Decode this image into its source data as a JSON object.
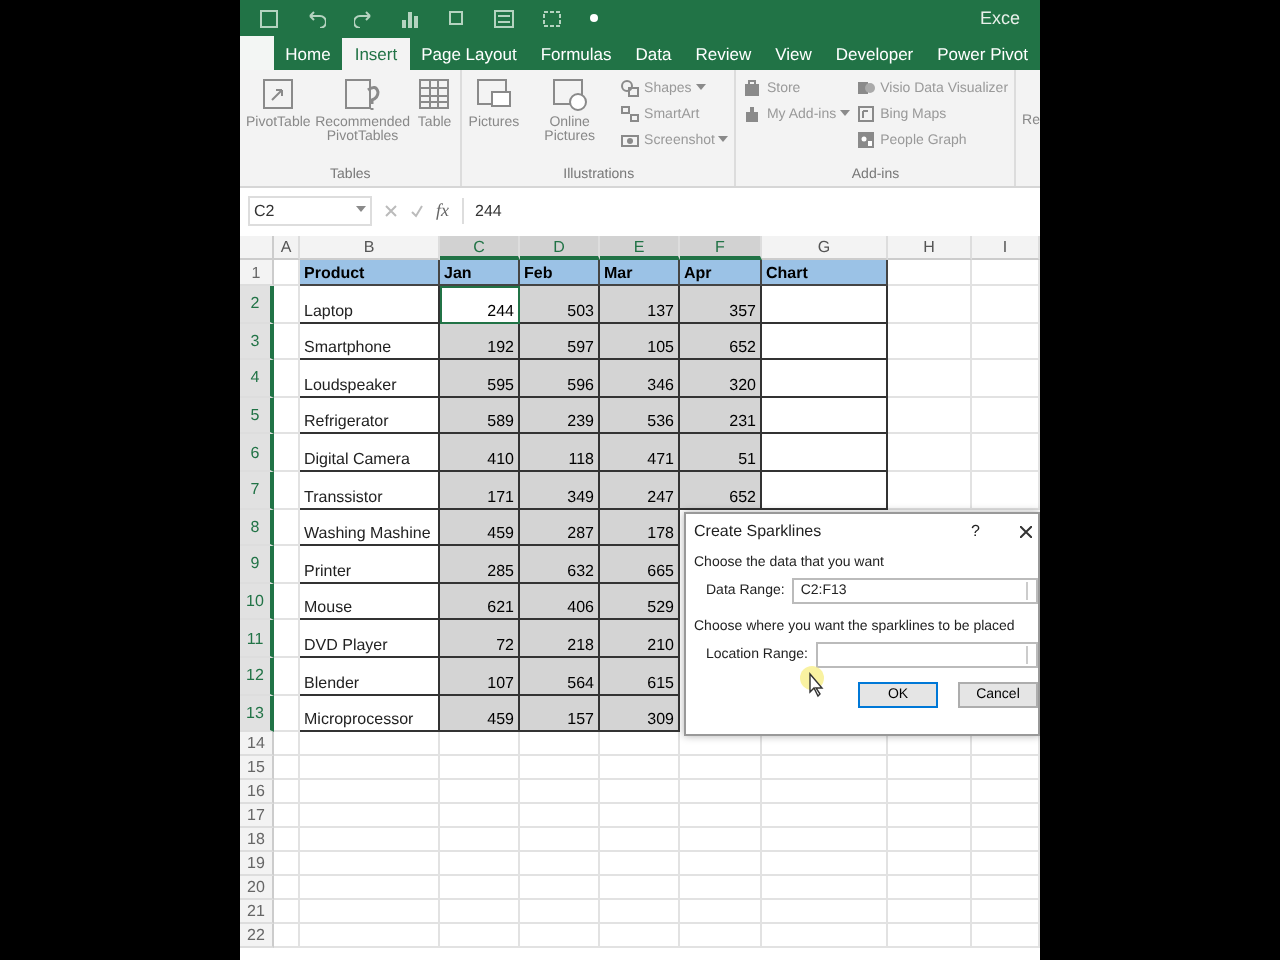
{
  "title_bar": {
    "app_title": "Exce"
  },
  "tabs": [
    {
      "label": "Home",
      "selected": false
    },
    {
      "label": "Insert",
      "selected": true
    },
    {
      "label": "Page Layout",
      "selected": false
    },
    {
      "label": "Formulas",
      "selected": false
    },
    {
      "label": "Data",
      "selected": false
    },
    {
      "label": "Review",
      "selected": false
    },
    {
      "label": "View",
      "selected": false
    },
    {
      "label": "Developer",
      "selected": false
    },
    {
      "label": "Power Pivot",
      "selected": false
    }
  ],
  "ribbon": {
    "groups": [
      {
        "label": "Tables",
        "items": [
          {
            "label": "PivotTable",
            "kind": "large"
          },
          {
            "label": "Recommended PivotTables",
            "kind": "large"
          },
          {
            "label": "Table",
            "kind": "large"
          }
        ]
      },
      {
        "label": "Illustrations",
        "items": [
          {
            "label": "Pictures",
            "kind": "large"
          },
          {
            "label": "Online Pictures",
            "kind": "large"
          },
          {
            "label": "Shapes",
            "kind": "small",
            "dropdown": true
          },
          {
            "label": "SmartArt",
            "kind": "small",
            "dropdown": false
          },
          {
            "label": "Screenshot",
            "kind": "small",
            "dropdown": true
          }
        ]
      },
      {
        "label": "Add-ins",
        "items": [
          {
            "label": "Store",
            "kind": "small",
            "dropdown": false
          },
          {
            "label": "My Add-ins",
            "kind": "small",
            "dropdown": true
          },
          {
            "label": "Visio Data Visualizer",
            "kind": "small",
            "dropdown": false
          },
          {
            "label": "Bing Maps",
            "kind": "small",
            "dropdown": false
          },
          {
            "label": "People Graph",
            "kind": "small",
            "dropdown": false
          }
        ]
      }
    ],
    "overflow_label": "Re"
  },
  "formula_bar": {
    "name_box": "C2",
    "function_label": "fx",
    "value": "244"
  },
  "sheet": {
    "columns": [
      {
        "label": "A",
        "selected": false
      },
      {
        "label": "B",
        "selected": false
      },
      {
        "label": "C",
        "selected": true
      },
      {
        "label": "D",
        "selected": true
      },
      {
        "label": "E",
        "selected": true
      },
      {
        "label": "F",
        "selected": true
      },
      {
        "label": "G",
        "selected": false
      },
      {
        "label": "H",
        "selected": false
      },
      {
        "label": "I",
        "selected": false
      }
    ],
    "header_row": {
      "number": "1",
      "cells": [
        "Product",
        "Jan",
        "Feb",
        "Mar",
        "Apr",
        "Chart"
      ]
    },
    "rows": [
      {
        "number": "2",
        "selected": true,
        "product": "Laptop",
        "values": [
          {
            "text": "244",
            "active": true
          },
          {
            "text": "503",
            "active": false
          },
          {
            "text": "137",
            "active": false
          },
          {
            "text": "357",
            "active": false
          }
        ]
      },
      {
        "number": "3",
        "selected": true,
        "product": "Smartphone",
        "values": [
          {
            "text": "192",
            "active": false
          },
          {
            "text": "597",
            "active": false
          },
          {
            "text": "105",
            "active": false
          },
          {
            "text": "652",
            "active": false
          }
        ]
      },
      {
        "number": "4",
        "selected": true,
        "product": "Loudspeaker",
        "values": [
          {
            "text": "595",
            "active": false
          },
          {
            "text": "596",
            "active": false
          },
          {
            "text": "346",
            "active": false
          },
          {
            "text": "320",
            "active": false
          }
        ]
      },
      {
        "number": "5",
        "selected": true,
        "product": "Refrigerator",
        "values": [
          {
            "text": "589",
            "active": false
          },
          {
            "text": "239",
            "active": false
          },
          {
            "text": "536",
            "active": false
          },
          {
            "text": "231",
            "active": false
          }
        ]
      },
      {
        "number": "6",
        "selected": true,
        "product": "Digital Camera",
        "values": [
          {
            "text": "410",
            "active": false
          },
          {
            "text": "118",
            "active": false
          },
          {
            "text": "471",
            "active": false
          },
          {
            "text": "51",
            "active": false
          }
        ]
      },
      {
        "number": "7",
        "selected": true,
        "product": "Transsistor",
        "values": [
          {
            "text": "171",
            "active": false
          },
          {
            "text": "349",
            "active": false
          },
          {
            "text": "247",
            "active": false
          },
          {
            "text": "652",
            "active": false
          }
        ]
      },
      {
        "number": "8",
        "selected": true,
        "product": "Washing Mashine",
        "values": [
          {
            "text": "459",
            "active": false
          },
          {
            "text": "287",
            "active": false
          },
          {
            "text": "178",
            "active": false
          }
        ]
      },
      {
        "number": "9",
        "selected": true,
        "product": "Printer",
        "values": [
          {
            "text": "285",
            "active": false
          },
          {
            "text": "632",
            "active": false
          },
          {
            "text": "665",
            "active": false
          }
        ]
      },
      {
        "number": "10",
        "selected": true,
        "product": "Mouse",
        "values": [
          {
            "text": "621",
            "active": false
          },
          {
            "text": "406",
            "active": false
          },
          {
            "text": "529",
            "active": false
          }
        ]
      },
      {
        "number": "11",
        "selected": true,
        "product": "DVD Player",
        "values": [
          {
            "text": "72",
            "active": false
          },
          {
            "text": "218",
            "active": false
          },
          {
            "text": "210",
            "active": false
          }
        ]
      },
      {
        "number": "12",
        "selected": true,
        "product": "Blender",
        "values": [
          {
            "text": "107",
            "active": false
          },
          {
            "text": "564",
            "active": false
          },
          {
            "text": "615",
            "active": false
          }
        ]
      },
      {
        "number": "13",
        "selected": true,
        "product": "Microprocessor",
        "values": [
          {
            "text": "459",
            "active": false
          },
          {
            "text": "157",
            "active": false
          },
          {
            "text": "309",
            "active": false
          }
        ]
      }
    ],
    "empty_rows": [
      "14",
      "15",
      "16",
      "17",
      "18",
      "19",
      "20",
      "21",
      "22"
    ]
  },
  "dialog": {
    "title": "Create Sparklines",
    "help": "?",
    "data_section": "Choose the data that you want",
    "data_label": "Data Range:",
    "data_value": "C2:F13",
    "location_section": "Choose where you want the sparklines to be placed",
    "location_label": "Location Range:",
    "buttons": [
      {
        "label": "OK",
        "default": true
      },
      {
        "label": "Cancel",
        "default": false
      }
    ]
  }
}
